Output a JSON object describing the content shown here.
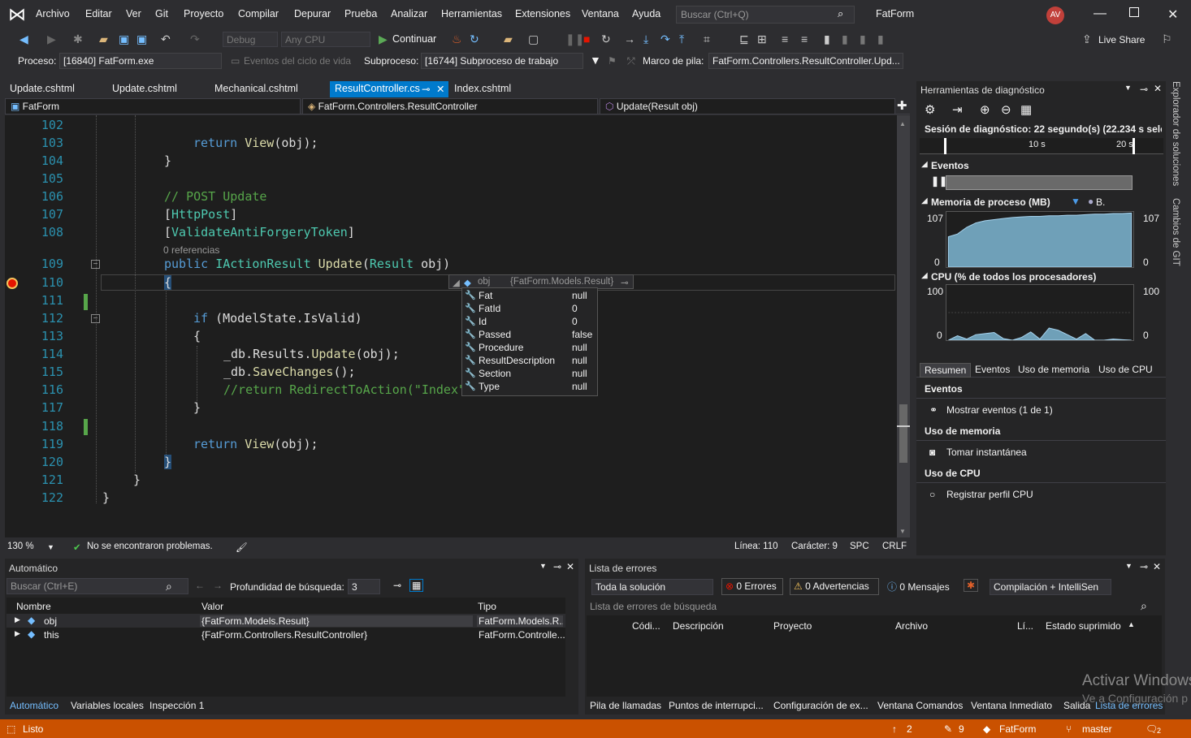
{
  "menu": {
    "items": [
      "Archivo",
      "Editar",
      "Ver",
      "Git",
      "Proyecto",
      "Compilar",
      "Depurar",
      "Prueba",
      "Analizar",
      "Herramientas",
      "Extensiones",
      "Ventana",
      "Ayuda"
    ],
    "search_placeholder": "Buscar (Ctrl+Q)",
    "solution": "FatForm",
    "avatar": "AV"
  },
  "toolbar": {
    "config": "Debug",
    "platform": "Any CPU",
    "continue": "Continuar",
    "live_share": "Live Share"
  },
  "process": {
    "label": "Proceso:",
    "value": "[16840] FatForm.exe",
    "lifecycle": "Eventos del ciclo de vida",
    "thread_label": "Subproceso:",
    "thread": "[16744] Subproceso de trabajo",
    "stack_label": "Marco de pila:",
    "stack": "FatForm.Controllers.ResultController.Upd..."
  },
  "tabs": [
    "Update.cshtml",
    "Update.cshtml",
    "Mechanical.cshtml",
    "ResultController.cs",
    "Index.cshtml"
  ],
  "nav": {
    "project": "FatForm",
    "class": "FatForm.Controllers.ResultController",
    "member": "Update(Result obj)"
  },
  "code": {
    "lines": [
      "102",
      "103",
      "104",
      "105",
      "106",
      "107",
      "108",
      "109",
      "110",
      "111",
      "112",
      "113",
      "114",
      "115",
      "116",
      "117",
      "118",
      "119",
      "120",
      "121",
      "122"
    ],
    "l103a": "return ",
    "l103b": "View",
    "l103c": "(obj);",
    "l104": "}",
    "l106": "// POST Update",
    "l107a": "[",
    "l107b": "HttpPost",
    "l107c": "]",
    "l108a": "[",
    "l108b": "ValidateAntiForgeryToken",
    "l108c": "]",
    "refs": "0 referencias",
    "l109a": "public ",
    "l109b": "IActionResult ",
    "l109c": "Update",
    "l109d": "(",
    "l109e": "Result ",
    "l109f": "obj)",
    "l110": "{",
    "l112a": "if ",
    "l112b": "(ModelState.IsValid)",
    "l113": "{",
    "l114a": "_db.Results.",
    "l114b": "Update",
    "l114c": "(obj);",
    "l115a": "_db.",
    "l115b": "SaveChanges",
    "l115c": "();",
    "l116": "//return RedirectToAction(\"Index\");",
    "l117": "}",
    "l119a": "return ",
    "l119b": "View",
    "l119c": "(obj);",
    "l120": "}",
    "l121": "}",
    "l122": "}"
  },
  "tooltip": {
    "name": "obj",
    "type": "{FatForm.Models.Result}",
    "rows": [
      {
        "n": "Fat",
        "v": "null"
      },
      {
        "n": "FatId",
        "v": "0"
      },
      {
        "n": "Id",
        "v": "0"
      },
      {
        "n": "Passed",
        "v": "false"
      },
      {
        "n": "Procedure",
        "v": "null"
      },
      {
        "n": "ResultDescription",
        "v": "null"
      },
      {
        "n": "Section",
        "v": "null"
      },
      {
        "n": "Type",
        "v": "null"
      }
    ]
  },
  "editor_status": {
    "zoom": "130 %",
    "problems": "No se encontraron problemas.",
    "line": "Línea: 110",
    "char": "Carácter: 9",
    "spc": "SPC",
    "crlf": "CRLF"
  },
  "diag": {
    "title": "Herramientas de diagnóstico",
    "session": "Sesión de diagnóstico: 22 segundo(s) (22.234 s selec...",
    "t10": "10 s",
    "t20": "20 s",
    "events": "Eventos",
    "memory": "Memoria de proceso (MB)",
    "mem_legend": "B.",
    "mem_max": "107",
    "mem_min": "0",
    "cpu": "CPU (% de todos los procesadores)",
    "cpu_max": "100",
    "cpu_min": "0",
    "tabs": [
      "Resumen",
      "Eventos",
      "Uso de memoria",
      "Uso de CPU"
    ],
    "sec_events": "Eventos",
    "show_events": "Mostrar eventos (1 de 1)",
    "sec_mem": "Uso de memoria",
    "snapshot": "Tomar instantánea",
    "sec_cpu": "Uso de CPU",
    "profile": "Registrar perfil CPU",
    "mem_series": [
      0.55,
      0.6,
      0.72,
      0.8,
      0.84,
      0.86,
      0.88,
      0.9,
      0.91,
      0.92,
      0.92,
      0.93,
      0.93,
      0.94,
      0.94,
      0.95,
      0.96,
      0.96,
      0.97,
      0.97,
      0.98
    ],
    "cpu_series": [
      0,
      0.08,
      0.02,
      0.1,
      0.12,
      0.14,
      0.03,
      0,
      0.05,
      0.15,
      0.02,
      0.22,
      0.18,
      0.1,
      0.02,
      0.12,
      0,
      0,
      0.02,
      0.01,
      0
    ]
  },
  "side": {
    "tab1": "Explorador de soluciones",
    "tab2": "Cambios de GIT"
  },
  "auto": {
    "title": "Automático",
    "search": "Buscar (Ctrl+E)",
    "depth_label": "Profundidad de búsqueda:",
    "depth": "3",
    "cols": [
      "Nombre",
      "Valor",
      "Tipo"
    ],
    "rows": [
      {
        "name": "obj",
        "value": "{FatForm.Models.Result}",
        "type": "FatForm.Models.R..."
      },
      {
        "name": "this",
        "value": "{FatForm.Controllers.ResultController}",
        "type": "FatForm.Controlle..."
      }
    ],
    "tabs": [
      "Automático",
      "Variables locales",
      "Inspección 1"
    ]
  },
  "errors": {
    "title": "Lista de errores",
    "scope": "Toda la solución",
    "err": "0 Errores",
    "warn": "0 Advertencias",
    "msg": "0 Mensajes",
    "build": "Compilación + IntelliSen",
    "search": "Lista de errores de búsqueda",
    "cols": [
      "Códi...",
      "Descripción",
      "Proyecto",
      "Archivo",
      "Lí...",
      "Estado suprimido"
    ],
    "tabs": [
      "Pila de llamadas",
      "Puntos de interrupci...",
      "Configuración de ex...",
      "Ventana Comandos",
      "Ventana Inmediato",
      "Salida",
      "Lista de errores"
    ]
  },
  "watermark": {
    "l1": "Activar Windows",
    "l2": "Ve a Configuración p"
  },
  "statusbar": {
    "ready": "Listo",
    "up": "2",
    "edits": "9",
    "repo": "FatForm",
    "branch": "master",
    "notif": "2"
  },
  "colors": {
    "accent": "#007acc",
    "status": "#ca5100"
  }
}
